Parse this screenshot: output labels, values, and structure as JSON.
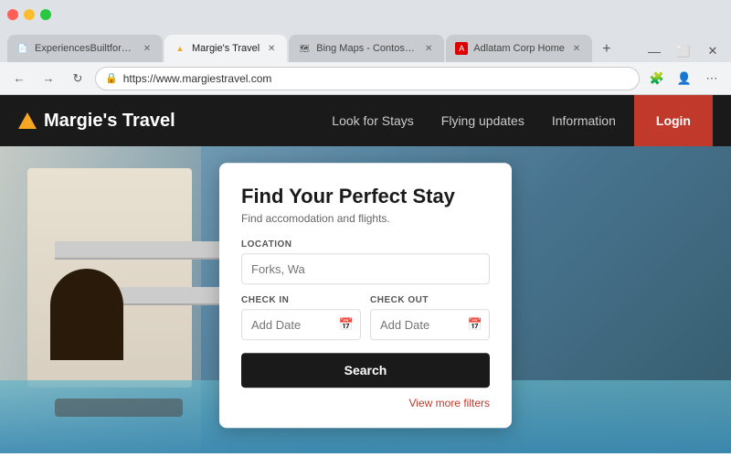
{
  "browser": {
    "tabs": [
      {
        "label": "ExperiencesBuiltforFocus.pdf",
        "active": false,
        "favicon": "📄"
      },
      {
        "label": "Margie's Travel",
        "active": true,
        "favicon": "✈"
      },
      {
        "label": "Bing Maps - Contosio HQ",
        "active": false,
        "favicon": "🗺"
      },
      {
        "label": "Adlatam Corp Home",
        "active": false,
        "favicon": "A"
      }
    ],
    "url": "https://www.margiestravel.com",
    "new_tab_icon": "+"
  },
  "navbar": {
    "logo_text": "Margie's Travel",
    "links": [
      {
        "label": "Look for Stays"
      },
      {
        "label": "Flying updates"
      },
      {
        "label": "Information"
      }
    ],
    "login_label": "Login"
  },
  "search_card": {
    "title": "Find Your Perfect Stay",
    "subtitle": "Find accomodation and flights.",
    "location_label": "LOCATION",
    "location_placeholder": "Forks, Wa",
    "checkin_label": "CHECK IN",
    "checkin_placeholder": "Add Date",
    "checkout_label": "CHECK OUT",
    "checkout_placeholder": "Add Date",
    "search_button": "Search",
    "view_more_filters": "View more filters"
  }
}
